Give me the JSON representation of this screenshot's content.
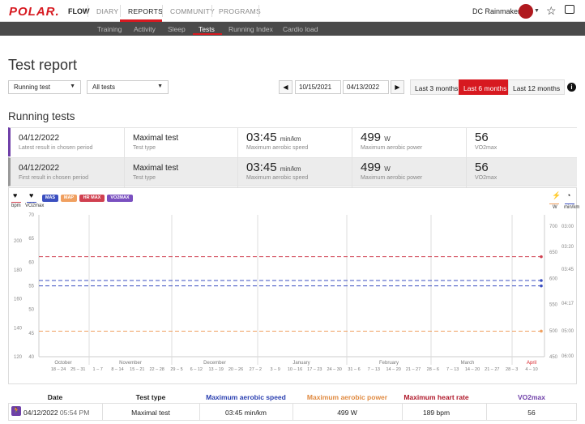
{
  "topnav": {
    "logo": "POLAR.",
    "product": "FLOW",
    "items": [
      "DIARY",
      "REPORTS",
      "COMMUNITY",
      "PROGRAMS"
    ],
    "active": "REPORTS",
    "user_name": "DC Rainmaker",
    "icons": [
      "avatar",
      "chevron-down-icon",
      "star-icon",
      "message-icon"
    ]
  },
  "subnav": {
    "items": [
      "Training",
      "Activity",
      "Sleep",
      "Tests",
      "Running Index",
      "Cardio load"
    ],
    "active": "Tests"
  },
  "page_title": "Test report",
  "filters": {
    "test_select": "Running test",
    "type_select": "All tests",
    "start_date": "10/15/2021",
    "end_date": "04/13/2022",
    "ranges": [
      "Last 3 months",
      "Last 6 months",
      "Last 12 months"
    ],
    "active_range": "Last 6 months"
  },
  "section_title": "Running tests",
  "results": [
    {
      "date": "04/12/2022",
      "date_sub": "Latest result in chosen period",
      "type": "Maximal test",
      "type_sub": "Test type",
      "speed": "03:45",
      "speed_unit": "min/km",
      "speed_sub": "Maximum aerobic speed",
      "power": "499",
      "power_unit": "W",
      "power_sub": "Maximum aerobic power",
      "vo2": "56",
      "vo2_sub": "VO2max"
    },
    {
      "date": "04/12/2022",
      "date_sub": "First result in chosen period",
      "type": "Maximal test",
      "type_sub": "Test type",
      "speed": "03:45",
      "speed_unit": "min/km",
      "speed_sub": "Maximum aerobic speed",
      "power": "499",
      "power_unit": "W",
      "power_sub": "Maximum aerobic power",
      "vo2": "56",
      "vo2_sub": "VO2max"
    }
  ],
  "chart_data": {
    "type": "line",
    "legend_left": [
      "bpm",
      "VO2max"
    ],
    "legend_right": [
      "W",
      "min/km"
    ],
    "series_toggles": [
      {
        "name": "MAS",
        "color": "#3b4fc0"
      },
      {
        "name": "MAP",
        "color": "#f0a060"
      },
      {
        "name": "HR MAX",
        "color": "#d04050"
      },
      {
        "name": "VO2MAX",
        "color": "#7a50c0"
      }
    ],
    "y_bpm_ticks": [
      "200",
      "180",
      "160",
      "140",
      "120"
    ],
    "y_vo2_ticks": [
      "70",
      "65",
      "60",
      "55",
      "50",
      "45",
      "40"
    ],
    "y_w_ticks": [
      "700",
      "650",
      "600",
      "550",
      "500",
      "450"
    ],
    "y_pace_ticks": [
      "03:00",
      "03:20",
      "03:45",
      "04:17",
      "05:00",
      "06:00"
    ],
    "months": [
      "October",
      "November",
      "December",
      "January",
      "February",
      "March",
      "April"
    ],
    "weeks": [
      "18 – 24",
      "25 – 31",
      "1 – 7",
      "8 – 14",
      "15 – 21",
      "22 – 28",
      "29 – 5",
      "6 – 12",
      "13 – 19",
      "20 – 26",
      "27 – 2",
      "3 – 9",
      "10 – 16",
      "17 – 23",
      "24 – 30",
      "31 – 6",
      "7 – 13",
      "14 – 20",
      "21 – 27",
      "28 – 6",
      "7 – 13",
      "14 – 20",
      "21 – 27",
      "28 – 3",
      "4 – 10"
    ],
    "reference_lines": [
      {
        "name": "HR MAX",
        "bpm": 189,
        "color": "#d04050"
      },
      {
        "name": "MAS",
        "pace": "03:45",
        "color": "#3b4fc0"
      },
      {
        "name": "VO2MAX",
        "vo2": 56,
        "color": "#3b4fc0"
      },
      {
        "name": "MAP",
        "watts": 499,
        "color": "#f0a060"
      }
    ]
  },
  "table": {
    "headers": [
      "Date",
      "Test type",
      "Maximum aerobic speed",
      "Maximum aerobic power",
      "Maximum heart rate",
      "VO2max"
    ],
    "header_colors": [
      "#222",
      "#222",
      "#2a3fb0",
      "#e08a40",
      "#b0182a",
      "#6f3fa8"
    ],
    "rows": [
      {
        "date": "04/12/2022",
        "time": "05:54 PM",
        "type": "Maximal test",
        "speed": "03:45 min/km",
        "power": "499 W",
        "hr": "189 bpm",
        "vo2": "56"
      }
    ]
  }
}
